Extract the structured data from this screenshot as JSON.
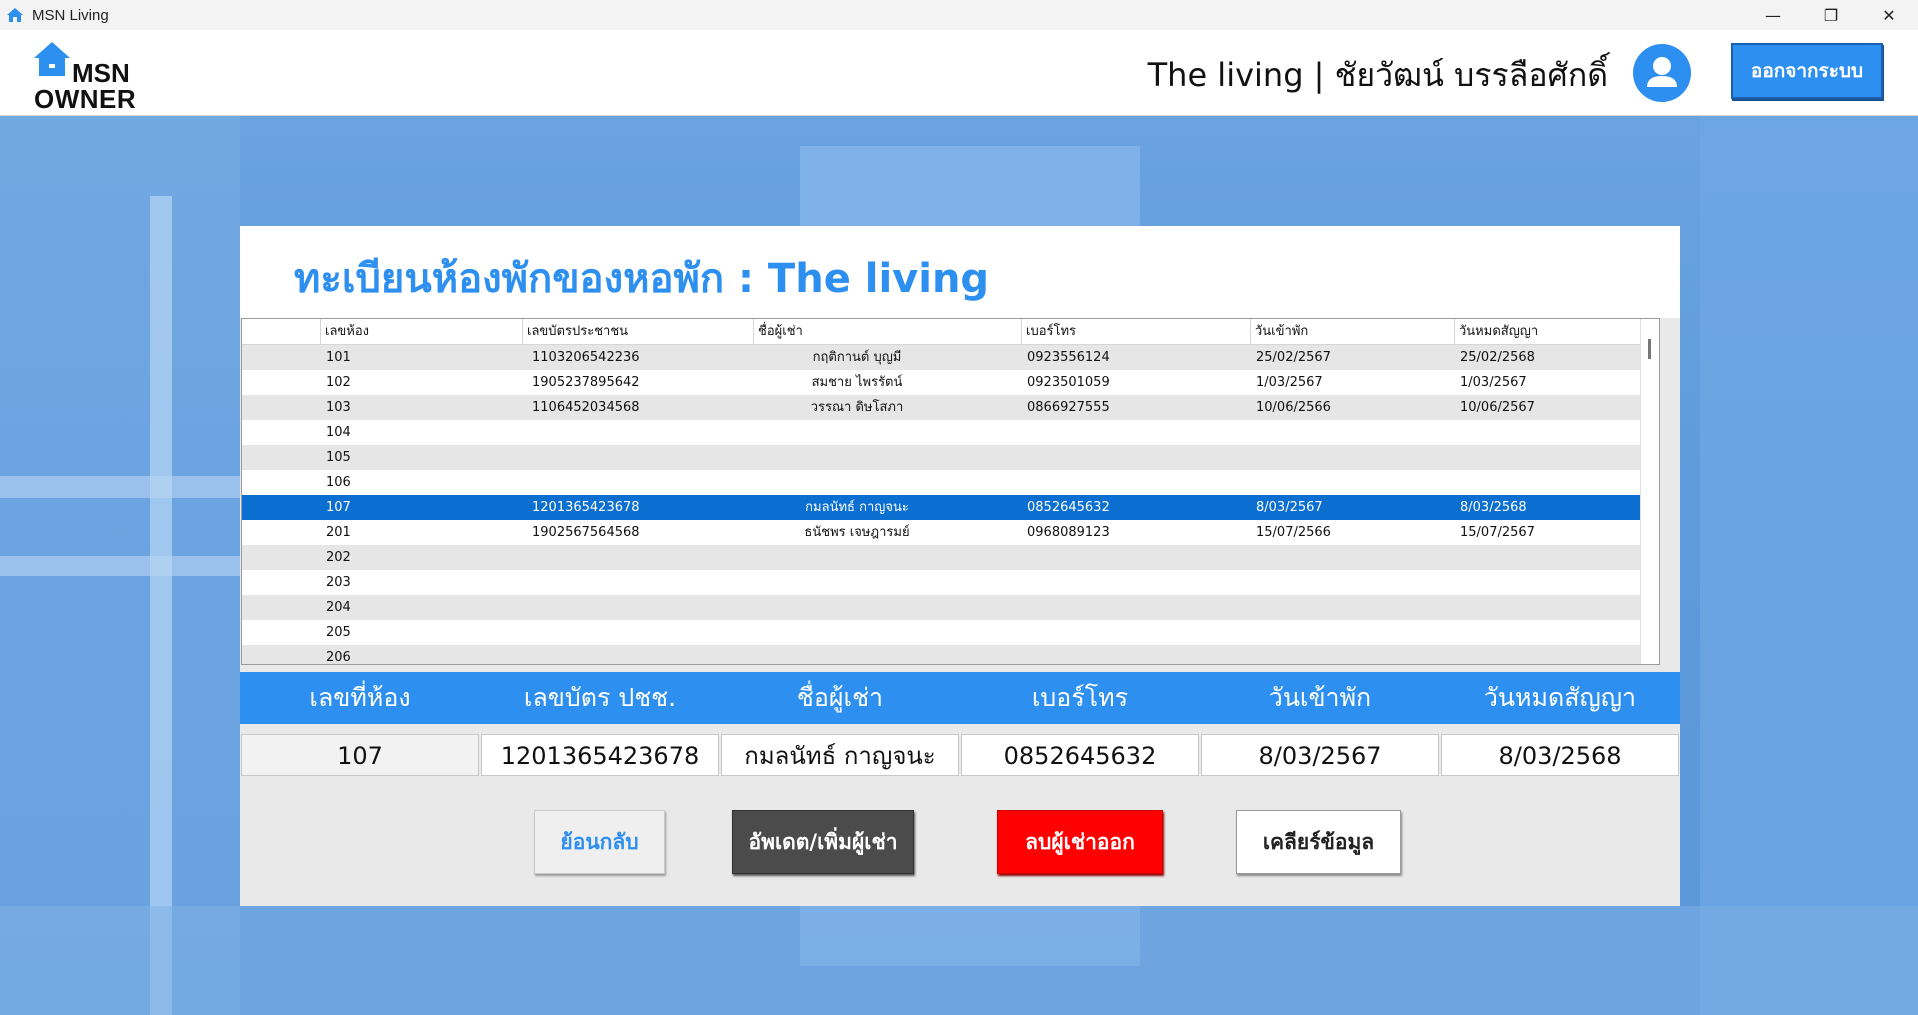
{
  "window": {
    "title": "MSN Living",
    "controls": [
      "—",
      "❐",
      "✕"
    ]
  },
  "header": {
    "logo_line1": "MSN",
    "logo_line2": "OWNER",
    "user_title": "The living | ชัยวัฒน์ บรรลือศักดิ์",
    "logout_label": "ออกจากระบบ"
  },
  "panel": {
    "title": "ทะเบียนห้องพักของหอพัก : The living"
  },
  "grid": {
    "columns": [
      "เลขห้อง",
      "เลขบัตรประชาชน",
      "ชื่อผู้เช่า",
      "เบอร์โทร",
      "วันเข้าพัก",
      "วันหมดสัญญา"
    ],
    "rows": [
      {
        "room": "101",
        "id": "1103206542236",
        "name": "กฤติกานต์ บุญมี",
        "phone": "0923556124",
        "checkin": "25/02/2567",
        "expire": "25/02/2568"
      },
      {
        "room": "102",
        "id": "1905237895642",
        "name": "สมชาย ไพรรัตน์",
        "phone": "0923501059",
        "checkin": "1/03/2567",
        "expire": "1/03/2567"
      },
      {
        "room": "103",
        "id": "1106452034568",
        "name": "วรรณา ดิษโสภา",
        "phone": "0866927555",
        "checkin": "10/06/2566",
        "expire": "10/06/2567"
      },
      {
        "room": "104",
        "id": "",
        "name": "",
        "phone": "",
        "checkin": "",
        "expire": ""
      },
      {
        "room": "105",
        "id": "",
        "name": "",
        "phone": "",
        "checkin": "",
        "expire": ""
      },
      {
        "room": "106",
        "id": "",
        "name": "",
        "phone": "",
        "checkin": "",
        "expire": ""
      },
      {
        "room": "107",
        "id": "1201365423678",
        "name": "กมลนัทธ์ กาญจนะ",
        "phone": "0852645632",
        "checkin": "8/03/2567",
        "expire": "8/03/2568"
      },
      {
        "room": "201",
        "id": "1902567564568",
        "name": "ธนัชพร เจษฎารมย์",
        "phone": "0968089123",
        "checkin": "15/07/2566",
        "expire": "15/07/2567"
      },
      {
        "room": "202",
        "id": "",
        "name": "",
        "phone": "",
        "checkin": "",
        "expire": ""
      },
      {
        "room": "203",
        "id": "",
        "name": "",
        "phone": "",
        "checkin": "",
        "expire": ""
      },
      {
        "room": "204",
        "id": "",
        "name": "",
        "phone": "",
        "checkin": "",
        "expire": ""
      },
      {
        "room": "205",
        "id": "",
        "name": "",
        "phone": "",
        "checkin": "",
        "expire": ""
      },
      {
        "room": "206",
        "id": "",
        "name": "",
        "phone": "",
        "checkin": "",
        "expire": ""
      }
    ],
    "selected_index": 6
  },
  "fields": {
    "labels": [
      "เลขที่ห้อง",
      "เลขบัตร ปชช.",
      "ชื่อผู้เช่า",
      "เบอร์โทร",
      "วันเข้าพัก",
      "วันหมดสัญญา"
    ],
    "values": [
      "107",
      "1201365423678",
      "กมลนัทธ์ กาญจนะ",
      "0852645632",
      "8/03/2567",
      "8/03/2568"
    ]
  },
  "buttons": {
    "back": "ย้อนกลับ",
    "update": "อัพเดต/เพิ่มผู้เช่า",
    "delete": "ลบผู้เช่าออก",
    "clear": "เคลียร์ข้อมูล"
  },
  "colors": {
    "accent": "#2d8ff0",
    "selected_row": "#0a6fd1",
    "delete": "#ff0000",
    "update": "#4b4b4b"
  }
}
